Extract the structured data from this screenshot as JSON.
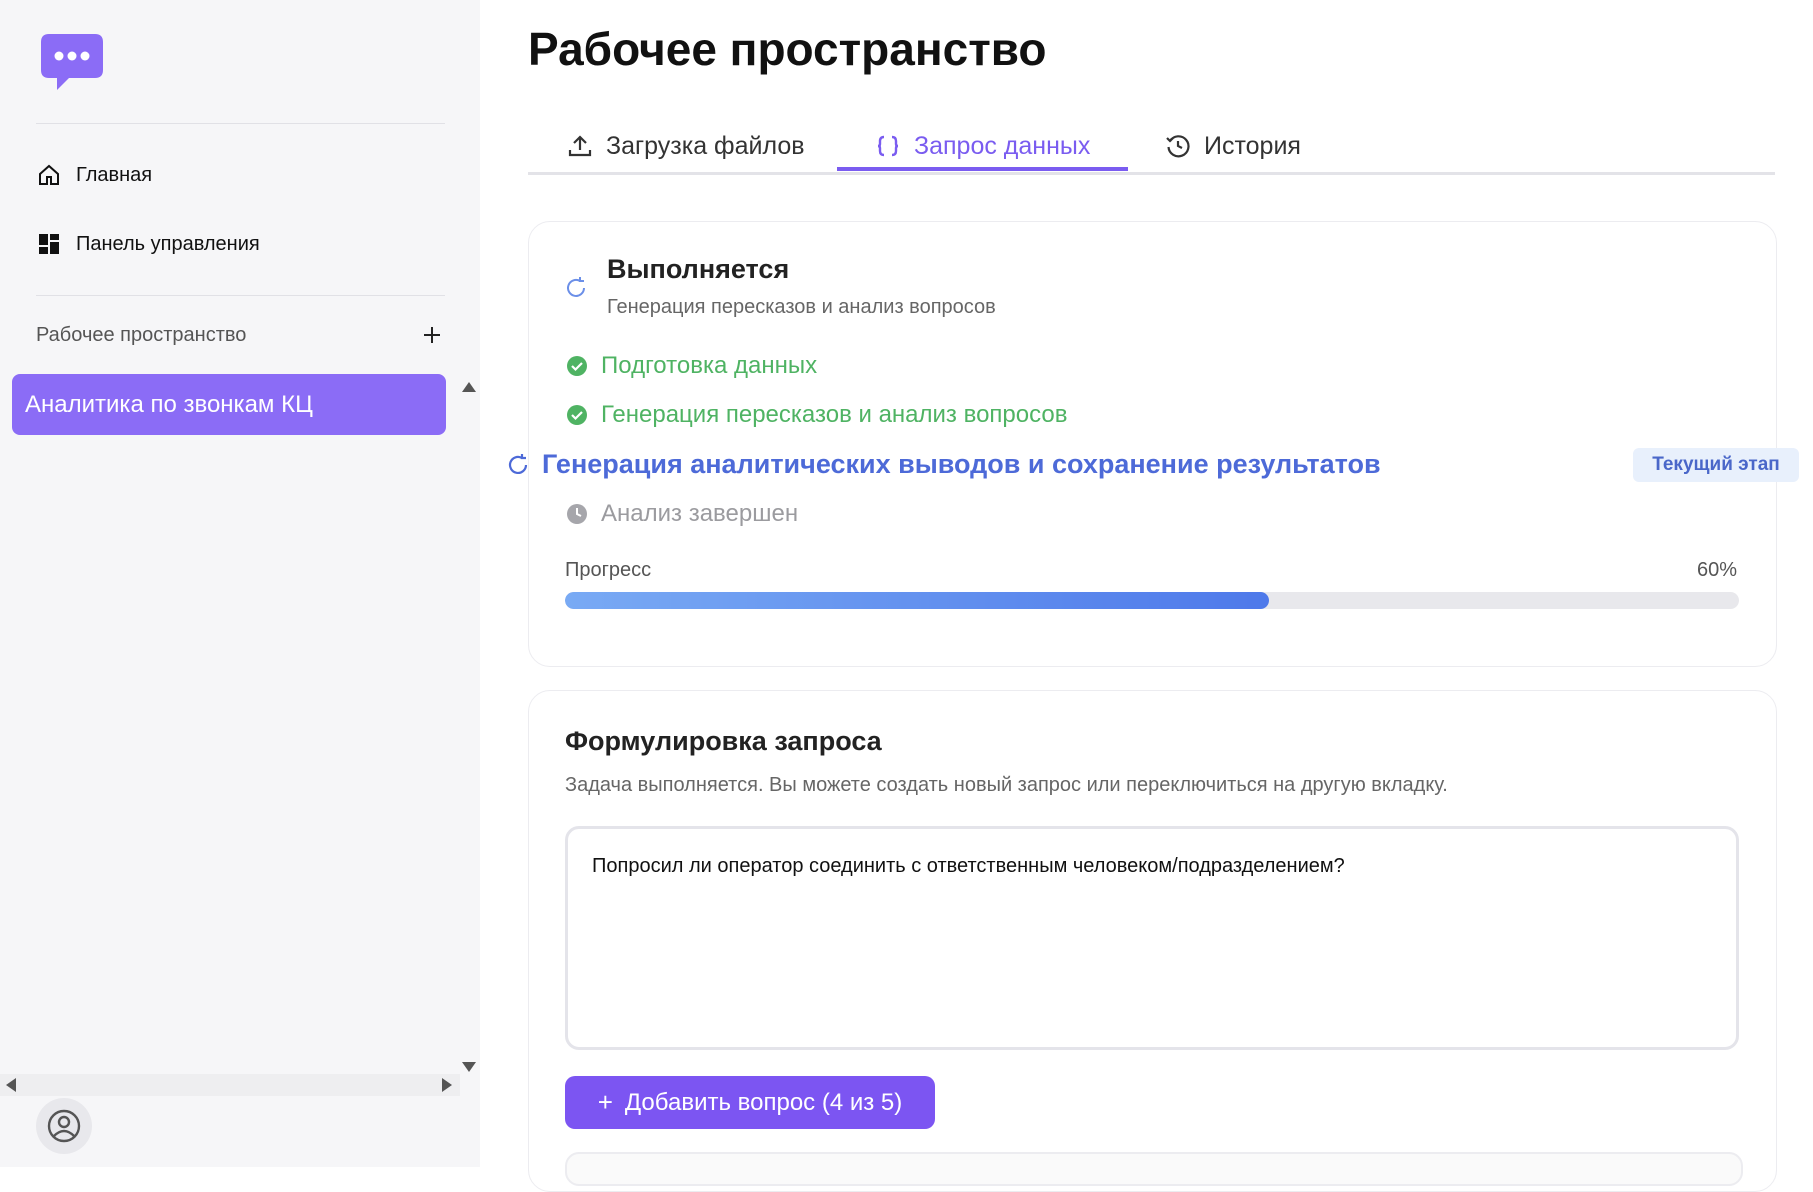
{
  "sidebar": {
    "logo_icon": "chat-bubble-icon",
    "nav": [
      {
        "label": "Главная",
        "icon": "home-icon"
      },
      {
        "label": "Панель управления",
        "icon": "dashboard-icon"
      }
    ],
    "workspaces_header": "Рабочее пространство",
    "workspaces": [
      {
        "label": "Аналитика по звонкам КЦ",
        "selected": true
      }
    ],
    "accent": "#8b6cf6"
  },
  "main": {
    "title": "Рабочее пространство",
    "tabs": [
      {
        "label": "Загрузка файлов",
        "icon": "upload-icon",
        "active": false
      },
      {
        "label": "Запрос данных",
        "icon": "braces-icon",
        "active": true
      },
      {
        "label": "История",
        "icon": "history-icon",
        "active": false
      }
    ],
    "status": {
      "title": "Выполняется",
      "subtitle": "Генерация пересказов и анализ вопросов",
      "steps": [
        {
          "label": "Подготовка данных",
          "state": "done"
        },
        {
          "label": "Генерация пересказов и анализ вопросов",
          "state": "done"
        },
        {
          "label": "Генерация аналитических выводов и сохранение результатов",
          "state": "current"
        },
        {
          "label": "Анализ завершен",
          "state": "pending"
        }
      ],
      "current_badge": "Текущий этап",
      "progress_label": "Прогресс",
      "progress_text": "60%",
      "progress_fraction": 0.6
    },
    "query": {
      "title": "Формулировка запроса",
      "subtitle": "Задача выполняется. Вы можете создать новый запрос или переключиться на другую вкладку.",
      "question_value": "Попросил ли оператор соединить с ответственным человеком/подразделением?",
      "add_button": "Добавить вопрос (4 из 5)"
    }
  },
  "colors": {
    "done": "#4fb363",
    "current": "#4d6ad8",
    "pending": "#9b9b9f",
    "button": "#7c55f2"
  }
}
